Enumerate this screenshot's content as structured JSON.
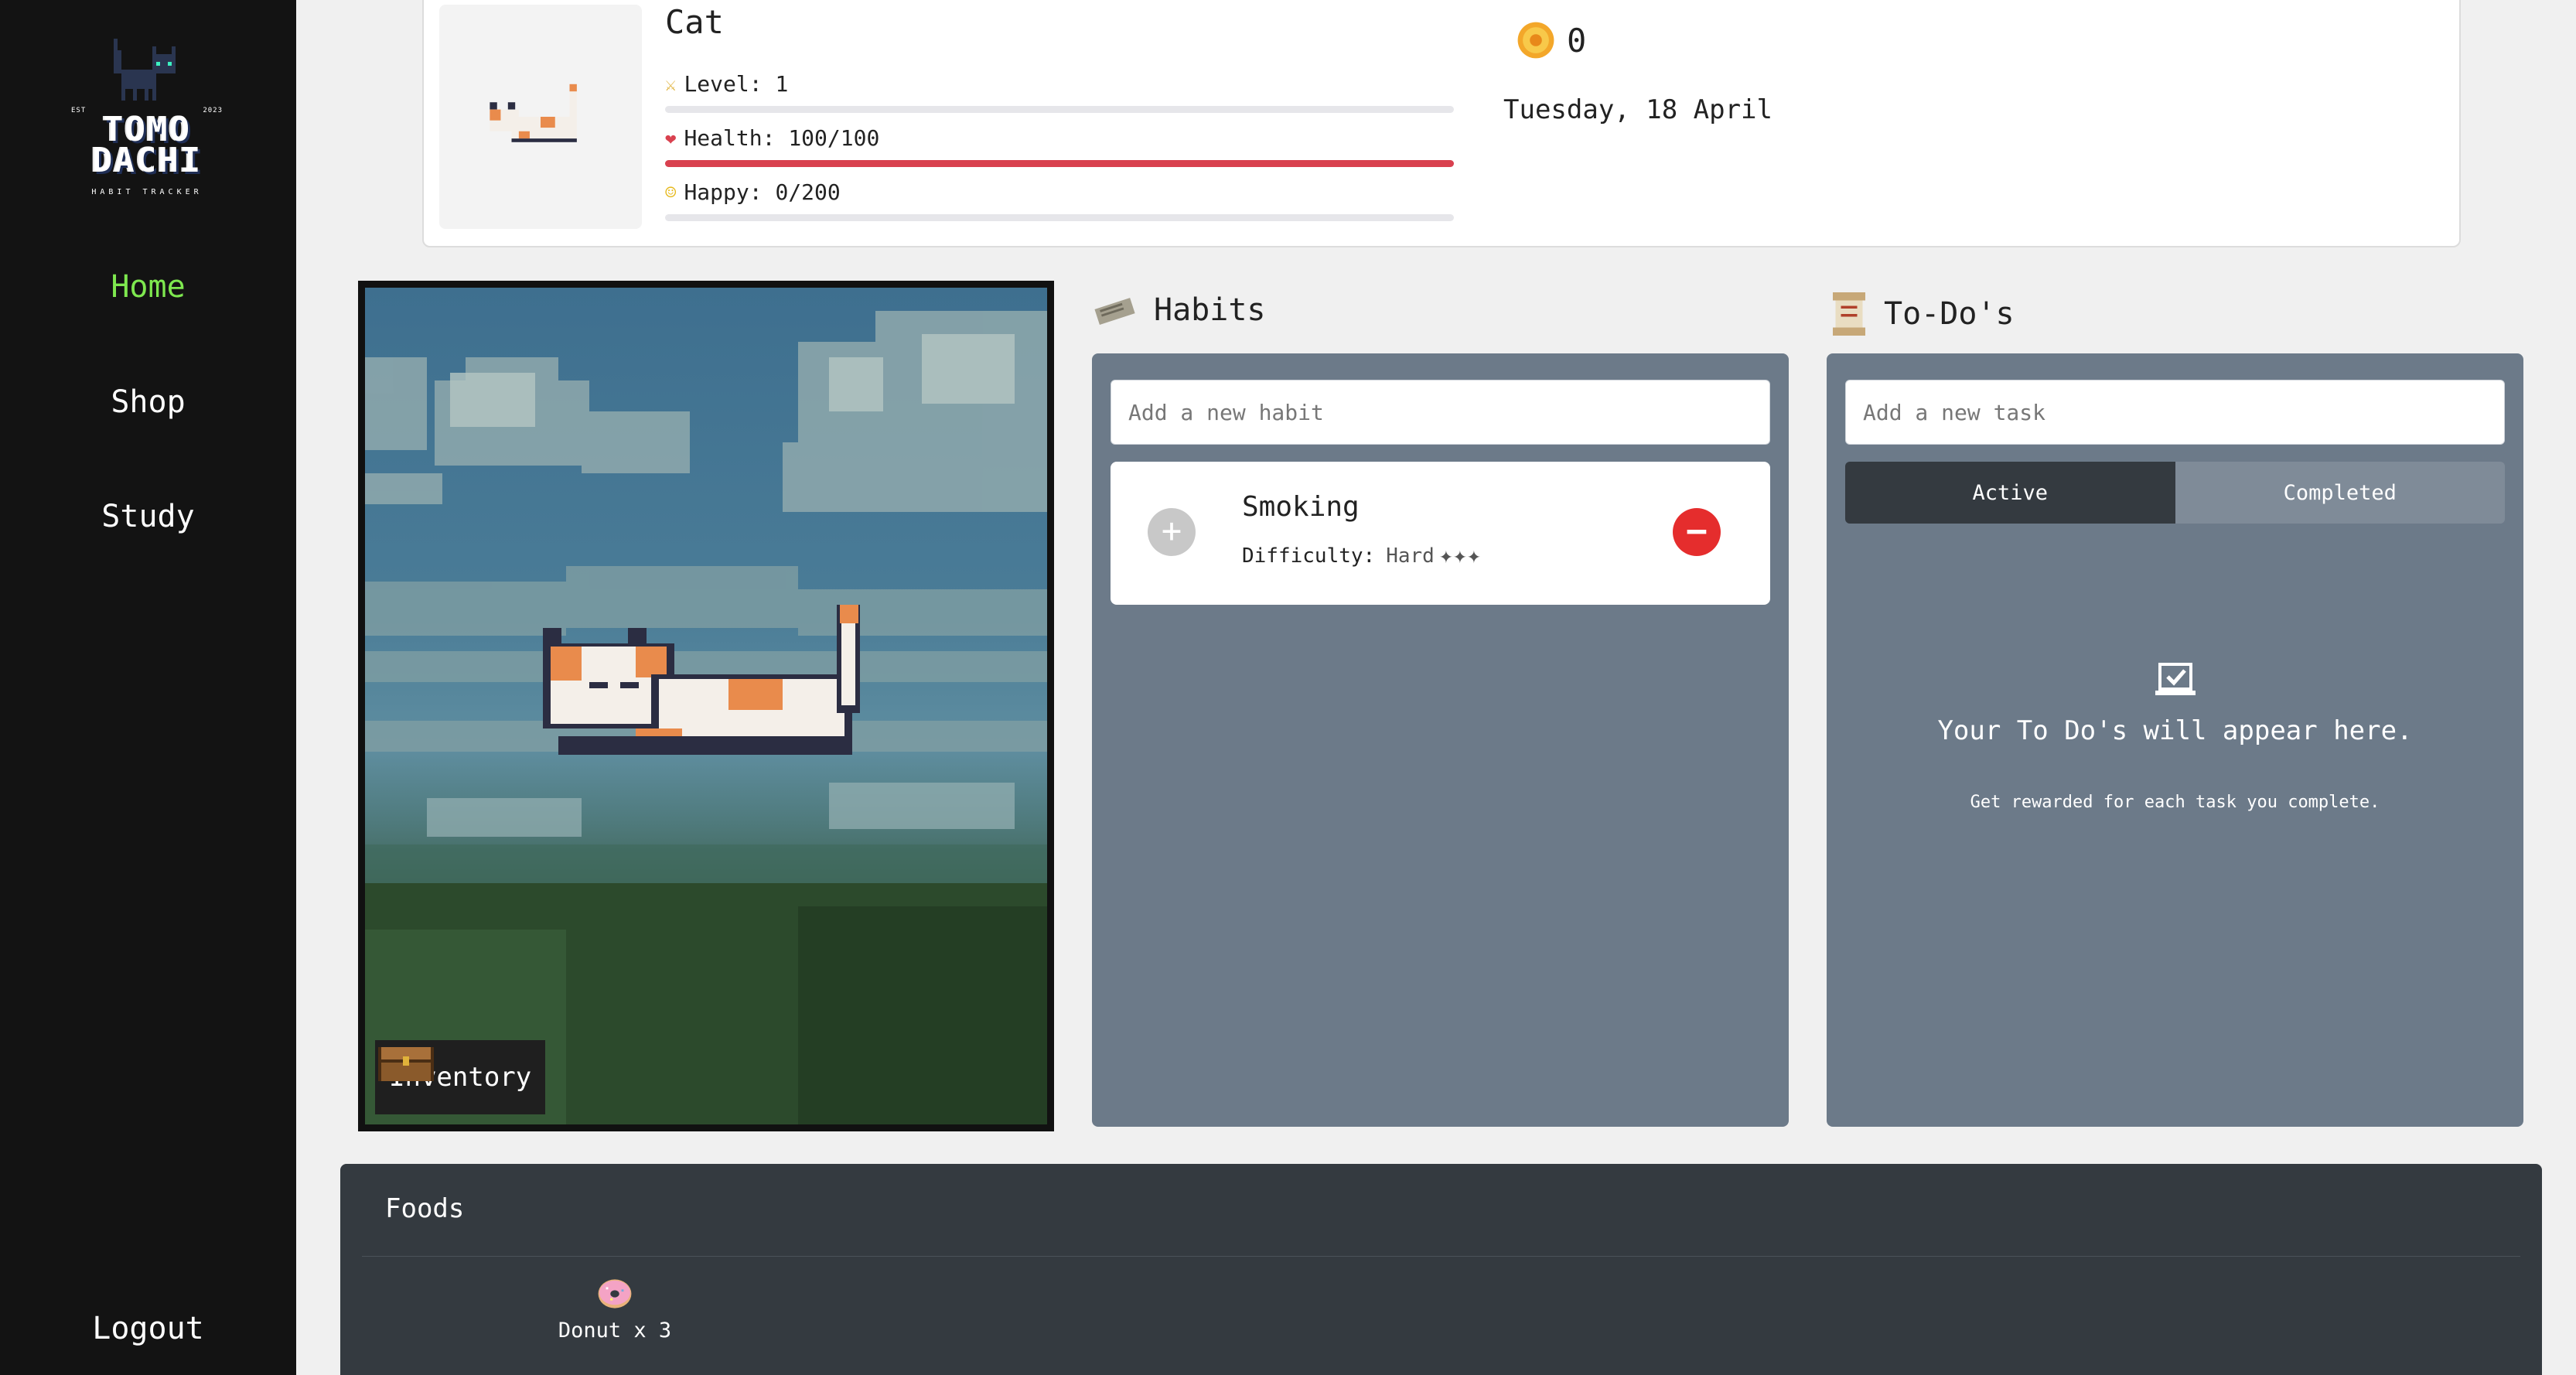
{
  "sidebar": {
    "logo": {
      "word_line1": "TOMO",
      "word_line2": "DACHI",
      "est_left": "EST",
      "est_right": "2023",
      "tagline": "HABIT TRACKER"
    },
    "nav": [
      {
        "label": "Home",
        "active": true
      },
      {
        "label": "Shop",
        "active": false
      },
      {
        "label": "Study",
        "active": false
      }
    ],
    "logout": "Logout"
  },
  "pet": {
    "name": "Cat",
    "level_label": "Level: 1",
    "level_progress": 0,
    "health_label": "Health: 100/100",
    "health_progress": 1.0,
    "happy_label": "Happy: 0/200",
    "happy_progress": 0
  },
  "coins": "0",
  "date": "Tuesday, 18 April",
  "inventory_label": "Inventory",
  "habits": {
    "title": "Habits",
    "placeholder": "Add a new habit",
    "items": [
      {
        "name": "Smoking",
        "difficulty_label": "Difficulty:",
        "difficulty_value": "Hard",
        "stars": "✦✦✦"
      }
    ]
  },
  "todos": {
    "title": "To-Do's",
    "placeholder": "Add a new task",
    "tabs": [
      {
        "label": "Active"
      },
      {
        "label": "Completed"
      }
    ],
    "empty_title": "Your To Do's will appear here.",
    "empty_subtitle": "Get rewarded for each task you complete."
  },
  "foods": {
    "title": "Foods",
    "items": [
      {
        "label": "Donut x 3",
        "icon": "donut-icon"
      }
    ]
  },
  "colors": {
    "accent_green": "#7ee84f",
    "health_red": "#d9414f",
    "panel": "#6c7a89",
    "dark": "#343a40"
  }
}
